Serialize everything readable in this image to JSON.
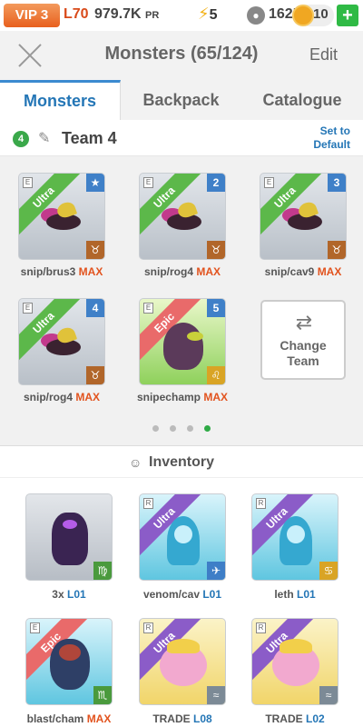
{
  "status": {
    "vip": "VIP 3",
    "level": "L70",
    "power": "979.7K",
    "power_unit": "PR",
    "energy": "5",
    "food": "162K",
    "gold": "10"
  },
  "header": {
    "title": "Monsters (65/124)",
    "edit": "Edit"
  },
  "tabs": [
    {
      "label": "Monsters",
      "active": true
    },
    {
      "label": "Backpack",
      "active": false
    },
    {
      "label": "Catalogue",
      "active": false
    }
  ],
  "team": {
    "number": "4",
    "name": "Team 4",
    "set_default": "Set to Default",
    "slots": [
      {
        "rarity": "Ultra",
        "tag": "★",
        "name": "snip/brus3",
        "level": "MAX",
        "element": "♉"
      },
      {
        "rarity": "Ultra",
        "tag": "2",
        "name": "snip/rog4",
        "level": "MAX",
        "element": "♉"
      },
      {
        "rarity": "Ultra",
        "tag": "3",
        "name": "snip/cav9",
        "level": "MAX",
        "element": "♉"
      },
      {
        "rarity": "Ultra",
        "tag": "4",
        "name": "snip/rog4",
        "level": "MAX",
        "element": "♉"
      },
      {
        "rarity": "Epic",
        "tag": "5",
        "name": "snipechamp",
        "level": "MAX",
        "element": "♌"
      }
    ],
    "change_team": "Change Team",
    "pages": 4,
    "active_page": 4
  },
  "inventory": {
    "title": "Inventory",
    "items": [
      {
        "rarity": "",
        "name": "3x",
        "level": "L01",
        "element": "♍"
      },
      {
        "rarity": "Ultra",
        "name": "venom/cav",
        "level": "L01",
        "element": "✈"
      },
      {
        "rarity": "Ultra",
        "name": "leth",
        "level": "L01",
        "element": "♋"
      },
      {
        "rarity": "Epic",
        "name": "blast/cham",
        "level": "MAX",
        "element": "♏"
      },
      {
        "rarity": "Ultra",
        "name": "TRADE",
        "level": "L08",
        "element": "≈"
      },
      {
        "rarity": "Ultra",
        "name": "TRADE",
        "level": "L02",
        "element": "≈"
      }
    ]
  },
  "colors": {
    "accent_blue": "#2476b6",
    "max_orange": "#e2531e",
    "active_green": "#2faa46",
    "vip_orange": "#e8601e"
  }
}
